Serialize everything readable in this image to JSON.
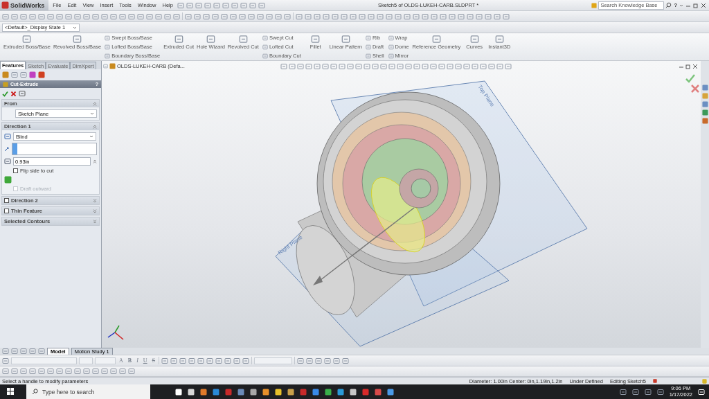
{
  "app": {
    "logo": "SolidWorks",
    "menus": [
      "File",
      "Edit",
      "View",
      "Insert",
      "Tools",
      "Window",
      "Help"
    ],
    "title": "Sketch5 of OLDS-LUKEH-CARB.SLDPRT *",
    "search": {
      "placeholder": "Search Knowledge Base"
    },
    "help": "?"
  },
  "display_state": "<Default>_Display State 1",
  "ribbon": [
    {
      "kind": "big",
      "label": "Extruded Boss/Base"
    },
    {
      "kind": "big",
      "label": "Revolved Boss/Base"
    },
    {
      "kind": "stack",
      "labels": [
        "Swept Boss/Base",
        "Lofted Boss/Base",
        "Boundary Boss/Base"
      ]
    },
    {
      "kind": "big",
      "label": "Extruded Cut"
    },
    {
      "kind": "big",
      "label": "Hole Wizard"
    },
    {
      "kind": "big",
      "label": "Revolved Cut"
    },
    {
      "kind": "stack",
      "labels": [
        "Swept Cut",
        "Lofted Cut",
        "Boundary Cut"
      ]
    },
    {
      "kind": "big",
      "label": "Fillet"
    },
    {
      "kind": "big",
      "label": "Linear Pattern"
    },
    {
      "kind": "stack",
      "labels": [
        "Rib",
        "Draft",
        "Shell"
      ]
    },
    {
      "kind": "stack",
      "labels": [
        "Wrap",
        "Dome",
        "Mirror"
      ]
    },
    {
      "kind": "big",
      "label": "Reference Geometry"
    },
    {
      "kind": "big",
      "label": "Curves"
    },
    {
      "kind": "big",
      "label": "Instant3D"
    }
  ],
  "feature_tabs": [
    {
      "label": "Features",
      "selected": true
    },
    {
      "label": "Sketch",
      "selected": false
    },
    {
      "label": "Evaluate",
      "selected": false
    },
    {
      "label": "DimXpert",
      "selected": false
    }
  ],
  "property_manager": {
    "title": "Cut-Extrude",
    "help": "?",
    "sections": [
      {
        "kind": "from",
        "title": "From",
        "expanded": true,
        "value": "Sketch Plane"
      },
      {
        "kind": "direction",
        "title": "Direction 1",
        "expanded": true,
        "end_condition": "Blind",
        "depth": "0.93in",
        "flip": {
          "label": "Flip side to cut",
          "checked": false
        },
        "draft": {
          "label": "Draft outward",
          "disabled": true
        }
      },
      {
        "kind": "toggle",
        "title": "Direction 2",
        "checked": false,
        "expanded": false
      },
      {
        "kind": "toggle",
        "title": "Thin Feature",
        "checked": false,
        "expanded": false
      },
      {
        "kind": "plain",
        "title": "Selected Contours",
        "expanded": false
      }
    ]
  },
  "tree": {
    "root": "OLDS-LUKEH-CARB  (Defa..."
  },
  "viewport": {
    "planes": [
      "Top Plane",
      "Right Plane"
    ]
  },
  "bottom_tabs": [
    {
      "label": "Model",
      "selected": true
    },
    {
      "label": "Motion Study 1",
      "selected": false
    }
  ],
  "format_buttons": [
    {
      "label": "A",
      "kind": "plain"
    },
    {
      "label": "B",
      "kind": "bold"
    },
    {
      "label": "I",
      "kind": "italic"
    },
    {
      "label": "U",
      "kind": "underline"
    },
    {
      "label": "S",
      "kind": "strike"
    }
  ],
  "status_bar": {
    "message": "Select a handle to modify parameters",
    "geometry": "Diameter: 1.00in  Center: 0in,1.19in,1.2in",
    "state": "Under Defined",
    "editing": "Editing Sketch5"
  },
  "taskbar": {
    "search": {
      "placeholder": "Type here to search"
    },
    "time": "9:06 PM",
    "date": "1/17/2022"
  }
}
